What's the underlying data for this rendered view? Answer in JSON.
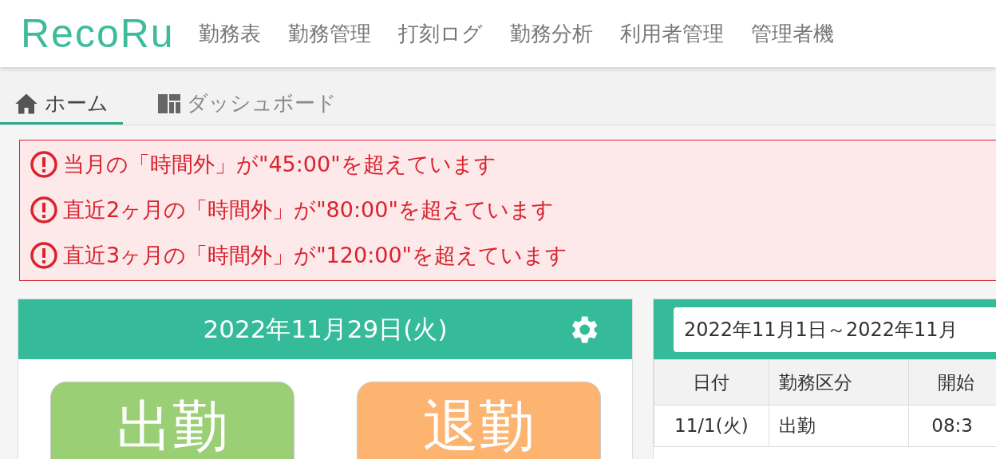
{
  "app": {
    "logo": "RecoRu"
  },
  "nav": [
    {
      "label": "勤務表"
    },
    {
      "label": "勤務管理"
    },
    {
      "label": "打刻ログ"
    },
    {
      "label": "勤務分析"
    },
    {
      "label": "利用者管理"
    },
    {
      "label": "管理者機"
    }
  ],
  "tabs": [
    {
      "label": "ホーム",
      "kind": "home",
      "selected": true
    },
    {
      "label": "ダッシュボード",
      "kind": "dashboard",
      "selected": false
    }
  ],
  "alerts": [
    "当月の「時間外」が\"45:00\"を超えています",
    "直近2ヶ月の「時間外」が\"80:00\"を超えています",
    "直近3ヶ月の「時間外」が\"120:00\"を超えています"
  ],
  "clock_card": {
    "date": "2022年11月29日(火)",
    "buttons": [
      {
        "label": "出勤",
        "kind": "clock_in"
      },
      {
        "label": "退勤",
        "kind": "clock_out"
      }
    ]
  },
  "attendance": {
    "period": "2022年11月1日～2022年11月",
    "columns": [
      "日付",
      "勤務区分",
      "開始"
    ],
    "rows": [
      [
        "11/1(火)",
        "出勤",
        "08:3"
      ]
    ]
  }
}
